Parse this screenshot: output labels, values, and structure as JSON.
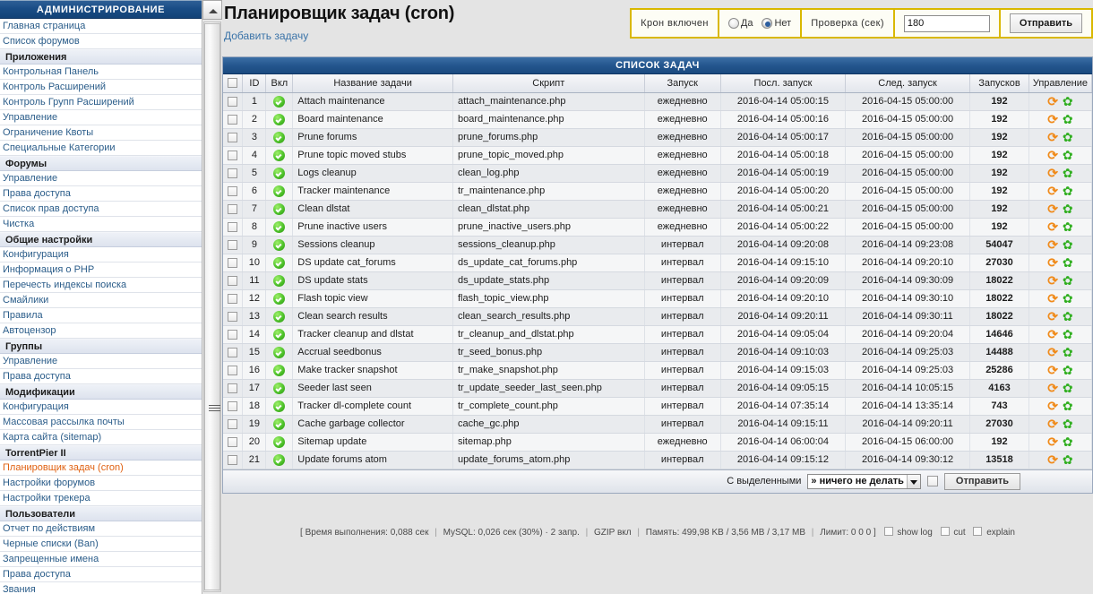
{
  "sidebar": {
    "title": "АДМИНИСТРИРОВАНИЕ",
    "items": [
      {
        "label": "Главная страница",
        "type": "link"
      },
      {
        "label": "Список форумов",
        "type": "link"
      },
      {
        "label": "Приложения",
        "type": "cat"
      },
      {
        "label": "Контрольная Панель",
        "type": "link"
      },
      {
        "label": "Контроль Расширений",
        "type": "link"
      },
      {
        "label": "Контроль Групп Расширений",
        "type": "link"
      },
      {
        "label": "Управление",
        "type": "link"
      },
      {
        "label": "Ограничение Квоты",
        "type": "link"
      },
      {
        "label": "Специальные Категории",
        "type": "link"
      },
      {
        "label": "Форумы",
        "type": "cat"
      },
      {
        "label": "Управление",
        "type": "link"
      },
      {
        "label": "Права доступа",
        "type": "link"
      },
      {
        "label": "Список прав доступа",
        "type": "link"
      },
      {
        "label": "Чистка",
        "type": "link"
      },
      {
        "label": "Общие настройки",
        "type": "cat"
      },
      {
        "label": "Конфигурация",
        "type": "link"
      },
      {
        "label": "Информация о PHP",
        "type": "link"
      },
      {
        "label": "Перечесть индексы поиска",
        "type": "link"
      },
      {
        "label": "Смайлики",
        "type": "link"
      },
      {
        "label": "Правила",
        "type": "link"
      },
      {
        "label": "Автоцензор",
        "type": "link"
      },
      {
        "label": "Группы",
        "type": "cat"
      },
      {
        "label": "Управление",
        "type": "link"
      },
      {
        "label": "Права доступа",
        "type": "link"
      },
      {
        "label": "Модификации",
        "type": "cat"
      },
      {
        "label": "Конфигурация",
        "type": "link"
      },
      {
        "label": "Массовая рассылка почты",
        "type": "link"
      },
      {
        "label": "Карта сайта (sitemap)",
        "type": "link"
      },
      {
        "label": "TorrentPier II",
        "type": "cat"
      },
      {
        "label": "Планировщик задач (cron)",
        "type": "active"
      },
      {
        "label": "Настройки форумов",
        "type": "link"
      },
      {
        "label": "Настройки трекера",
        "type": "link"
      },
      {
        "label": "Пользователи",
        "type": "cat"
      },
      {
        "label": "Отчет по действиям",
        "type": "link"
      },
      {
        "label": "Черные списки (Ban)",
        "type": "link"
      },
      {
        "label": "Запрещенные имена",
        "type": "link"
      },
      {
        "label": "Права доступа",
        "type": "link"
      },
      {
        "label": "Звания",
        "type": "link"
      }
    ]
  },
  "header": {
    "title": "Планировщик задач (cron)",
    "add_task": "Добавить задачу"
  },
  "cron_panel": {
    "enabled_label": "Крон включен",
    "yes_label": "Да",
    "no_label": "Нет",
    "selected": "no",
    "check_label": "Проверка (сек)",
    "check_value": "180",
    "submit_label": "Отправить",
    "border_color": "#d9b800"
  },
  "table": {
    "caption": "СПИСОК ЗАДАЧ",
    "columns": {
      "id": "ID",
      "on": "Вкл",
      "name": "Название задачи",
      "script": "Скрипт",
      "run": "Запуск",
      "last": "Посл. запуск",
      "next": "След. запуск",
      "count": "Запусков",
      "control": "Управление"
    },
    "rows": [
      {
        "id": "1",
        "on": true,
        "name": "Attach maintenance",
        "script": "attach_maintenance.php",
        "run": "ежедневно",
        "last": "2016-04-14 05:00:15",
        "next": "2016-04-15 05:00:00",
        "count": "192"
      },
      {
        "id": "2",
        "on": true,
        "name": "Board maintenance",
        "script": "board_maintenance.php",
        "run": "ежедневно",
        "last": "2016-04-14 05:00:16",
        "next": "2016-04-15 05:00:00",
        "count": "192"
      },
      {
        "id": "3",
        "on": true,
        "name": "Prune forums",
        "script": "prune_forums.php",
        "run": "ежедневно",
        "last": "2016-04-14 05:00:17",
        "next": "2016-04-15 05:00:00",
        "count": "192"
      },
      {
        "id": "4",
        "on": true,
        "name": "Prune topic moved stubs",
        "script": "prune_topic_moved.php",
        "run": "ежедневно",
        "last": "2016-04-14 05:00:18",
        "next": "2016-04-15 05:00:00",
        "count": "192"
      },
      {
        "id": "5",
        "on": true,
        "name": "Logs cleanup",
        "script": "clean_log.php",
        "run": "ежедневно",
        "last": "2016-04-14 05:00:19",
        "next": "2016-04-15 05:00:00",
        "count": "192"
      },
      {
        "id": "6",
        "on": true,
        "name": "Tracker maintenance",
        "script": "tr_maintenance.php",
        "run": "ежедневно",
        "last": "2016-04-14 05:00:20",
        "next": "2016-04-15 05:00:00",
        "count": "192"
      },
      {
        "id": "7",
        "on": true,
        "name": "Clean dlstat",
        "script": "clean_dlstat.php",
        "run": "ежедневно",
        "last": "2016-04-14 05:00:21",
        "next": "2016-04-15 05:00:00",
        "count": "192"
      },
      {
        "id": "8",
        "on": true,
        "name": "Prune inactive users",
        "script": "prune_inactive_users.php",
        "run": "ежедневно",
        "last": "2016-04-14 05:00:22",
        "next": "2016-04-15 05:00:00",
        "count": "192"
      },
      {
        "id": "9",
        "on": true,
        "name": "Sessions cleanup",
        "script": "sessions_cleanup.php",
        "run": "интервал",
        "last": "2016-04-14 09:20:08",
        "next": "2016-04-14 09:23:08",
        "count": "54047"
      },
      {
        "id": "10",
        "on": true,
        "name": "DS update cat_forums",
        "script": "ds_update_cat_forums.php",
        "run": "интервал",
        "last": "2016-04-14 09:15:10",
        "next": "2016-04-14 09:20:10",
        "count": "27030"
      },
      {
        "id": "11",
        "on": true,
        "name": "DS update stats",
        "script": "ds_update_stats.php",
        "run": "интервал",
        "last": "2016-04-14 09:20:09",
        "next": "2016-04-14 09:30:09",
        "count": "18022"
      },
      {
        "id": "12",
        "on": true,
        "name": "Flash topic view",
        "script": "flash_topic_view.php",
        "run": "интервал",
        "last": "2016-04-14 09:20:10",
        "next": "2016-04-14 09:30:10",
        "count": "18022"
      },
      {
        "id": "13",
        "on": true,
        "name": "Clean search results",
        "script": "clean_search_results.php",
        "run": "интервал",
        "last": "2016-04-14 09:20:11",
        "next": "2016-04-14 09:30:11",
        "count": "18022"
      },
      {
        "id": "14",
        "on": true,
        "name": "Tracker cleanup and dlstat",
        "script": "tr_cleanup_and_dlstat.php",
        "run": "интервал",
        "last": "2016-04-14 09:05:04",
        "next": "2016-04-14 09:20:04",
        "count": "14646"
      },
      {
        "id": "15",
        "on": true,
        "name": "Accrual seedbonus",
        "script": "tr_seed_bonus.php",
        "run": "интервал",
        "last": "2016-04-14 09:10:03",
        "next": "2016-04-14 09:25:03",
        "count": "14488"
      },
      {
        "id": "16",
        "on": true,
        "name": "Make tracker snapshot",
        "script": "tr_make_snapshot.php",
        "run": "интервал",
        "last": "2016-04-14 09:15:03",
        "next": "2016-04-14 09:25:03",
        "count": "25286"
      },
      {
        "id": "17",
        "on": true,
        "name": "Seeder last seen",
        "script": "tr_update_seeder_last_seen.php",
        "run": "интервал",
        "last": "2016-04-14 09:05:15",
        "next": "2016-04-14 10:05:15",
        "count": "4163"
      },
      {
        "id": "18",
        "on": true,
        "name": "Tracker dl-complete count",
        "script": "tr_complete_count.php",
        "run": "интервал",
        "last": "2016-04-14 07:35:14",
        "next": "2016-04-14 13:35:14",
        "count": "743"
      },
      {
        "id": "19",
        "on": true,
        "name": "Cache garbage collector",
        "script": "cache_gc.php",
        "run": "интервал",
        "last": "2016-04-14 09:15:11",
        "next": "2016-04-14 09:20:11",
        "count": "27030"
      },
      {
        "id": "20",
        "on": true,
        "name": "Sitemap update",
        "script": "sitemap.php",
        "run": "ежедневно",
        "last": "2016-04-14 06:00:04",
        "next": "2016-04-15 06:00:00",
        "count": "192"
      },
      {
        "id": "21",
        "on": true,
        "name": "Update forums atom",
        "script": "update_forums_atom.php",
        "run": "интервал",
        "last": "2016-04-14 09:15:12",
        "next": "2016-04-14 09:30:12",
        "count": "13518"
      }
    ]
  },
  "bulk": {
    "label": "С выделенными",
    "selected_option": "» ничего не делать",
    "submit_label": "Отправить"
  },
  "status": {
    "open": "[",
    "exec_time": "Время выполнения: 0,088 сек",
    "mysql": "MySQL: 0,026 сек (30%) · 2 запр.",
    "gzip": "GZIP вкл",
    "memory": "Память: 499,98 KB / 3,56 MB / 3,17 MB",
    "limit": "Лимит: 0 0 0",
    "close": "]",
    "show_log": "show log",
    "cut": "cut",
    "explain": "explain"
  },
  "icons": {
    "refresh": "⟳",
    "gear": "✿"
  }
}
